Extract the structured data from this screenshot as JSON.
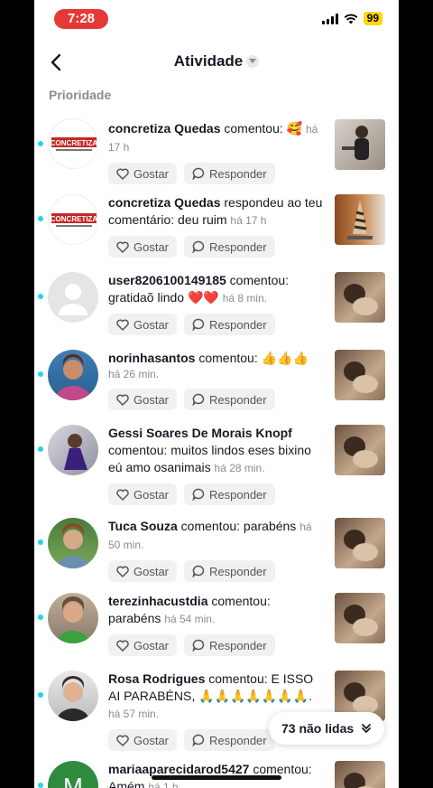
{
  "status": {
    "time": "7:28",
    "battery": "99"
  },
  "header": {
    "title": "Atividade"
  },
  "section": "Prioridade",
  "actions": {
    "like": "Gostar",
    "reply": "Responder"
  },
  "items": [
    {
      "user": "concretiza Quedas",
      "text": " comentou: 🥰",
      "ago": "há 17 h",
      "avatar": "logo"
    },
    {
      "user": "concretiza Quedas",
      "text": " respondeu ao teu comentário: deu ruim",
      "ago": "há 17 h",
      "avatar": "logo"
    },
    {
      "user": "user8206100149185",
      "text": " comentou: gratidaõ lindo ❤️❤️",
      "ago": "há 8 min.",
      "avatar": "default"
    },
    {
      "user": "norinhasantos",
      "text": " comentou: 👍👍👍",
      "ago": "há 26 min.",
      "avatar": "photo"
    },
    {
      "user": "Gessi Soares De Morais Knopf",
      "text": " comentou: muitos lindos eses bixino eú amo osanimais",
      "ago": "há 28 min.",
      "avatar": "photo"
    },
    {
      "user": "Tuca Souza",
      "text": " comentou: parabéns",
      "ago": "há 50 min.",
      "avatar": "photo"
    },
    {
      "user": "terezinhacustdia",
      "text": " comentou: parabéns",
      "ago": "há 54 min.",
      "avatar": "photo"
    },
    {
      "user": "Rosa Rodrigues",
      "text": " comentou: E ISSO AI PARABÉNS, 🙏🙏🙏🙏🙏🙏🙏.",
      "ago": "há 57 min.",
      "avatar": "photo"
    },
    {
      "user": "mariaaparecidarod5427",
      "text": " comentou: Amém",
      "ago": "há 1 h",
      "avatar": "letter",
      "letter": "M"
    }
  ],
  "unread": {
    "label": "73 não lidas"
  },
  "colors": {
    "unread_dot": "#20d5ec",
    "time_pill": "#e53935",
    "battery": "#ffd60a"
  }
}
